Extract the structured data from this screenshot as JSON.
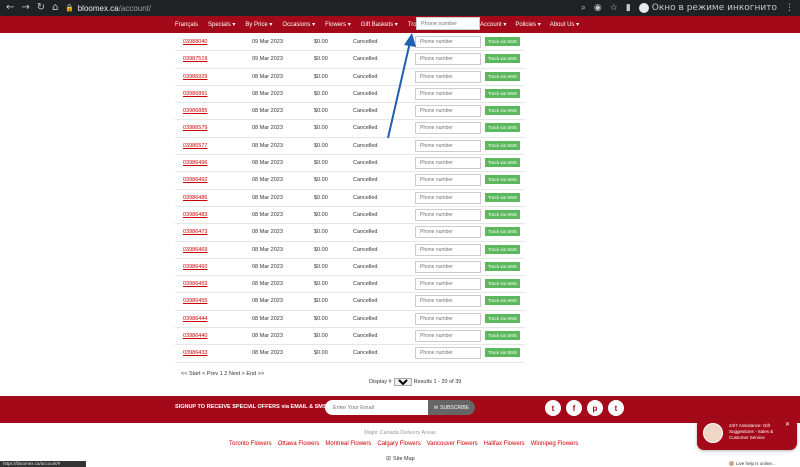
{
  "browser": {
    "url_host": "bloomex.ca",
    "url_path": "/account/",
    "incognito_label": "Окно в режиме инкогнито"
  },
  "nav": {
    "items": [
      "Français",
      "Specials ▾",
      "By Price ▾",
      "Occasions ▾",
      "Flowers ▾",
      "Gift Baskets ▾",
      "Tropical Plan"
    ],
    "right_items": [
      "Account ▾",
      "Policies ▾",
      "About Us ▾"
    ],
    "search_placeholder": "Phone number"
  },
  "orders": {
    "phone_placeholder": "Phone number",
    "sms_label": "Track via SMS",
    "rows": [
      {
        "number": "03988040",
        "date": "09 Mar 2023",
        "amount": "$0.00",
        "status": "Cancelled"
      },
      {
        "number": "03987519",
        "date": "09 Mar 2023",
        "amount": "$0.00",
        "status": "Cancelled"
      },
      {
        "number": "03986929",
        "date": "08 Mar 2023",
        "amount": "$0.00",
        "status": "Cancelled"
      },
      {
        "number": "03986891",
        "date": "08 Mar 2023",
        "amount": "$0.00",
        "status": "Cancelled"
      },
      {
        "number": "03986885",
        "date": "08 Mar 2023",
        "amount": "$0.00",
        "status": "Cancelled"
      },
      {
        "number": "03986579",
        "date": "08 Mar 2023",
        "amount": "$0.00",
        "status": "Cancelled"
      },
      {
        "number": "03986577",
        "date": "08 Mar 2023",
        "amount": "$0.00",
        "status": "Cancelled"
      },
      {
        "number": "03986496",
        "date": "08 Mar 2023",
        "amount": "$0.00",
        "status": "Cancelled"
      },
      {
        "number": "03986492",
        "date": "08 Mar 2023",
        "amount": "$0.00",
        "status": "Cancelled"
      },
      {
        "number": "03986486",
        "date": "08 Mar 2023",
        "amount": "$0.00",
        "status": "Cancelled"
      },
      {
        "number": "03986483",
        "date": "08 Mar 2023",
        "amount": "$0.00",
        "status": "Cancelled"
      },
      {
        "number": "03986473",
        "date": "08 Mar 2023",
        "amount": "$0.00",
        "status": "Cancelled"
      },
      {
        "number": "03986469",
        "date": "08 Mar 2023",
        "amount": "$0.00",
        "status": "Cancelled"
      },
      {
        "number": "03986460",
        "date": "08 Mar 2023",
        "amount": "$0.00",
        "status": "Cancelled"
      },
      {
        "number": "03986459",
        "date": "08 Mar 2023",
        "amount": "$0.00",
        "status": "Cancelled"
      },
      {
        "number": "03986455",
        "date": "08 Mar 2023",
        "amount": "$0.00",
        "status": "Cancelled"
      },
      {
        "number": "03986444",
        "date": "08 Mar 2023",
        "amount": "$0.00",
        "status": "Cancelled"
      },
      {
        "number": "03986440",
        "date": "08 Mar 2023",
        "amount": "$0.00",
        "status": "Cancelled"
      },
      {
        "number": "03986433",
        "date": "08 Mar 2023",
        "amount": "$0.00",
        "status": "Cancelled"
      }
    ]
  },
  "pagination": {
    "links": "<< Start < Prev 1 2 Next > End >>",
    "display_label": "Display #",
    "display_value": "20",
    "results": "Results 1 - 20 of 39"
  },
  "footer": {
    "signup": "SIGNUP TO RECEIVE SPECIAL OFFERS via EMAIL & SMS",
    "email_placeholder": "Enter Your Email",
    "subscribe_label": "SUBSCRIBE",
    "social_icons": [
      "twitter-icon",
      "facebook-icon",
      "pinterest-icon",
      "twitter-icon"
    ],
    "areas_title": "Major Canada Delivery Areas",
    "areas": [
      "Toronto Flowers",
      "Ottawa Flowers",
      "Montreal Flowers",
      "Calgary Flowers",
      "Vancouver Flowers",
      "Halifax Flowers",
      "Winnipeg Flowers"
    ],
    "sitemap": "Site Map"
  },
  "chat": {
    "text": "24/7 Assistance: Gift Suggestions - Sales & Customer Service",
    "live_label": "Live help is online..."
  },
  "statusbar": "https://bloomex.ca/account/#",
  "colors": {
    "brand_red": "#a4091a",
    "sms_green": "#5cb85c",
    "link_red": "#cc0000",
    "annotation_arrow": "#1f5fb4"
  }
}
